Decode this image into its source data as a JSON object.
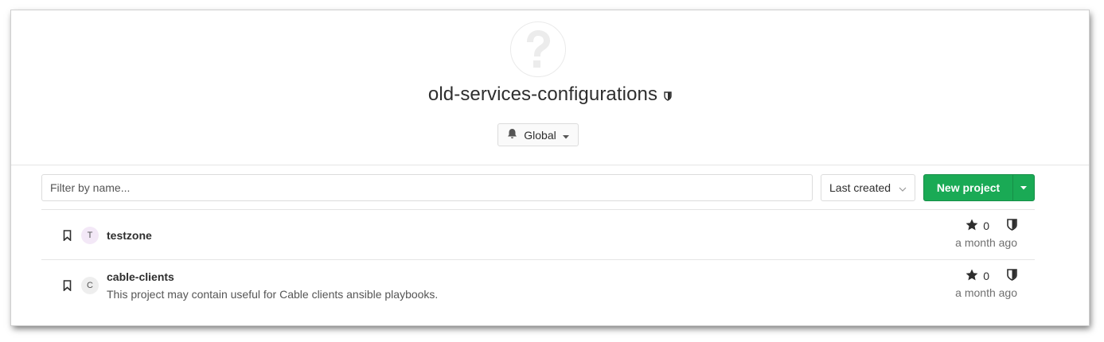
{
  "group": {
    "name": "old-services-configurations",
    "avatar_icon": "question-mark-icon",
    "visibility_icon": "shield-icon"
  },
  "notifications": {
    "label": "Global",
    "icon": "bell-icon"
  },
  "toolbar": {
    "filter_placeholder": "Filter by name...",
    "sort_label": "Last created",
    "new_project_label": "New project"
  },
  "colors": {
    "primary": "#1aaa55",
    "border": "#e5e5e5",
    "text": "#2e2e2e"
  },
  "projects": [
    {
      "initial": "T",
      "avatar_color": "#f3e8f7",
      "name": "testzone",
      "description": "",
      "stars": "0",
      "updated": "a month ago"
    },
    {
      "initial": "C",
      "avatar_color": "#eeeeee",
      "name": "cable-clients",
      "description": "This project may contain useful for Cable clients ansible playbooks.",
      "stars": "0",
      "updated": "a month ago"
    }
  ]
}
